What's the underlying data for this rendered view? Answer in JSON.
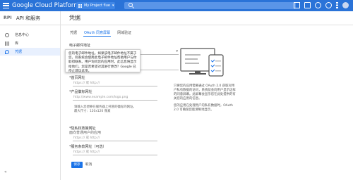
{
  "topbar": {
    "brand": "Google Cloud Platform",
    "project": "My Project flue"
  },
  "sidebar": {
    "api_logo": "RPI",
    "title": "API 和服务",
    "items": [
      {
        "label": "信息中心"
      },
      {
        "label": "库"
      },
      {
        "label": "凭据"
      }
    ],
    "collapse": "«"
  },
  "content": {
    "title": "凭据",
    "tabs": [
      {
        "label": "凭据"
      },
      {
        "label": "OAuth 同意屏幕"
      },
      {
        "label": "网域验证"
      }
    ],
    "email_label": "电子邮件地址",
    "tooltip": "您的电子邮件地址。如果该电子邮件地址不属于您，则系统会使用此电子邮件地址帮助用户与你取得联系。用户询问您的应用时，此信息将显示给他们。您是否希望对其进行更改？Google 已停止建议此项。",
    "homepage_label": "*首页网址",
    "homepage_value": "https:// 或 http://",
    "logo_label": "*产品徽标网址",
    "logo_value": "http://www.example.com/logo.png",
    "upload_hint": "请输入您想要在服务器上托管的徽标的网址，最大尺寸：120x120 像素",
    "privacy_label": "*隐私权政策网址",
    "privacy_sub": "面向普通用户的应用",
    "privacy_value": "https:// 或 http://",
    "tos_label": "*服务条款网址（可选）",
    "tos_value": "https:// 或 http://",
    "create_button": "保存",
    "cancel_button": "取消"
  },
  "info": {
    "para1": "只要您的应用需要通过 OAuth 2.0 获取对用户私有数据的访问，系统就会向用户显示这样的同意屏幕。此屏幕会显示您在此处提供的有关您的应用的信息。",
    "para2": "您的应用在处理用户的私有数据时，OAuth 2.0 可确保您能清晰地显示。"
  },
  "colors": {
    "topbar": "#2a73d8",
    "accent": "#1a73e8"
  }
}
